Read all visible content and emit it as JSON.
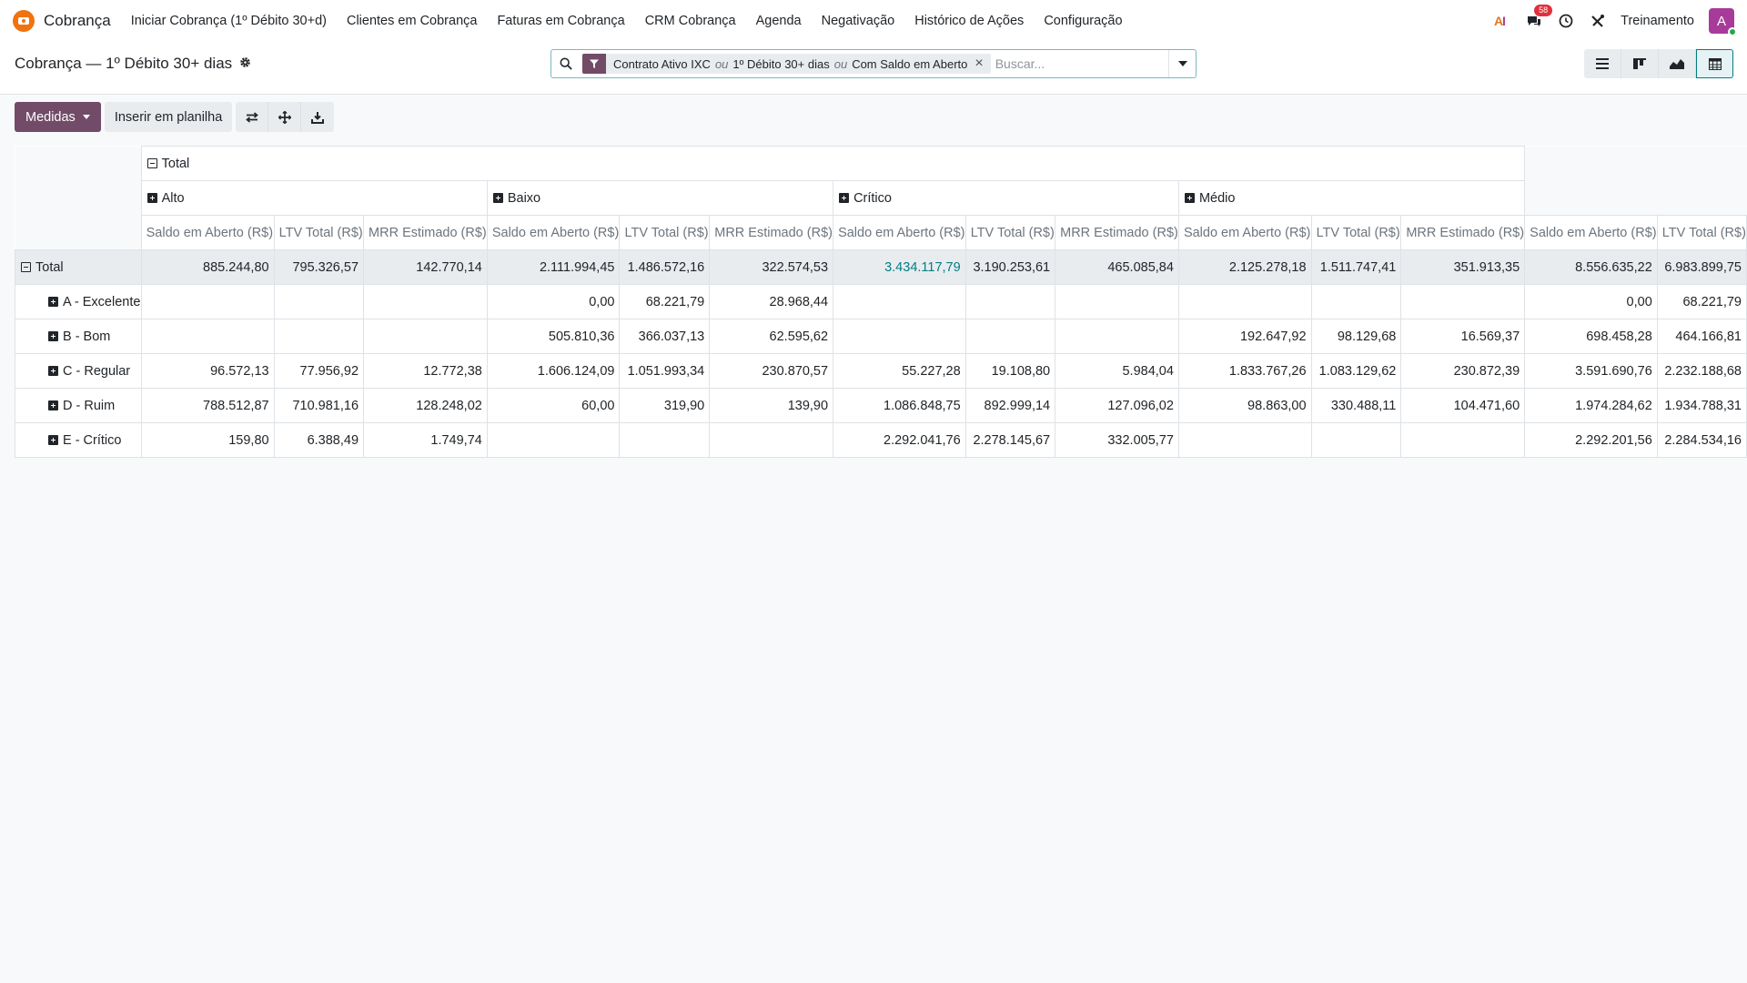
{
  "app": {
    "name": "Cobrança"
  },
  "nav": {
    "items": [
      "Iniciar Cobrança (1º Débito 30+d)",
      "Clientes em Cobrança",
      "Faturas em Cobrança",
      "CRM Cobrança",
      "Agenda",
      "Negativação",
      "Histórico de Ações",
      "Configuração"
    ],
    "badge_count": "58",
    "company": "Treinamento",
    "avatar_letter": "A"
  },
  "control": {
    "title": "Cobrança — 1º Débito 30+ dias",
    "facet_values": [
      "Contrato Ativo IXC",
      "1º Débito 30+ dias",
      "Com Saldo em Aberto"
    ],
    "facet_separator": "ou",
    "search_placeholder": "Buscar..."
  },
  "actions": {
    "measures_label": "Medidas",
    "insert_label": "Inserir em planilha"
  },
  "colors": {
    "brand": "#714b67",
    "accent": "#017e84",
    "logo": "#f0730f",
    "badge": "#e02f3d"
  },
  "pivot": {
    "col_total": "Total",
    "groups": [
      "Alto",
      "Baixo",
      "Crítico",
      "Médio"
    ],
    "measures": [
      "Saldo em Aberto (R$)",
      "LTV Total (R$)",
      "MRR Estimado (R$)"
    ],
    "rows": [
      {
        "label": "Total",
        "values": [
          "885.244,80",
          "795.326,57",
          "142.770,14",
          "2.111.994,45",
          "1.486.572,16",
          "322.574,53",
          "3.434.117,79",
          "3.190.253,61",
          "465.085,84",
          "2.125.278,18",
          "1.511.747,41",
          "351.913,35",
          "8.556.635,22",
          "6.983.899,75"
        ]
      },
      {
        "label": "A - Excelente",
        "values": [
          "",
          "",
          "",
          "0,00",
          "68.221,79",
          "28.968,44",
          "",
          "",
          "",
          "",
          "",
          "",
          "0,00",
          "68.221,79"
        ]
      },
      {
        "label": "B - Bom",
        "values": [
          "",
          "",
          "",
          "505.810,36",
          "366.037,13",
          "62.595,62",
          "",
          "",
          "",
          "192.647,92",
          "98.129,68",
          "16.569,37",
          "698.458,28",
          "464.166,81"
        ]
      },
      {
        "label": "C - Regular",
        "values": [
          "96.572,13",
          "77.956,92",
          "12.772,38",
          "1.606.124,09",
          "1.051.993,34",
          "230.870,57",
          "55.227,28",
          "19.108,80",
          "5.984,04",
          "1.833.767,26",
          "1.083.129,62",
          "230.872,39",
          "3.591.690,76",
          "2.232.188,68"
        ]
      },
      {
        "label": "D - Ruim",
        "values": [
          "788.512,87",
          "710.981,16",
          "128.248,02",
          "60,00",
          "319,90",
          "139,90",
          "1.086.848,75",
          "892.999,14",
          "127.096,02",
          "98.863,00",
          "330.488,11",
          "104.471,60",
          "1.974.284,62",
          "1.934.788,31"
        ]
      },
      {
        "label": "E - Crítico",
        "values": [
          "159,80",
          "6.388,49",
          "1.749,74",
          "",
          "",
          "",
          "2.292.041,76",
          "2.278.145,67",
          "332.005,77",
          "",
          "",
          "",
          "2.292.201,56",
          "2.284.534,16"
        ]
      }
    ]
  }
}
